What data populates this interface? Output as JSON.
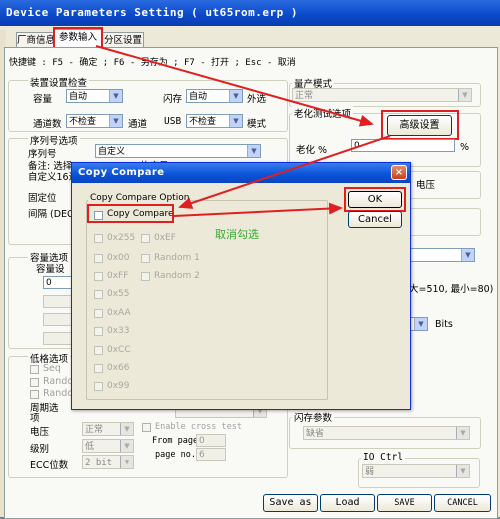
{
  "window": {
    "title": "Device Parameters Setting ( ut65rom.erp )"
  },
  "tabs": [
    {
      "label": "厂商信息"
    },
    {
      "label": "参数输入"
    },
    {
      "label": "分区设置"
    }
  ],
  "shortcut": "快捷键 : F5 - 确定 ; F6 - 另存为 ; F7 - 打开 ; Esc - 取消",
  "device_check": {
    "title": "装置设置检查",
    "capacity_label": "容量",
    "capacity_value": "自动",
    "flash_label": "闪存",
    "flash_value": "自动",
    "outside_label": "外选",
    "channel_count_label": "通道数",
    "channel_count_value": "不检查",
    "channel_label": "通道",
    "usb_label": "USB",
    "usb_value": "不检查",
    "mode_label": "模式"
  },
  "serial": {
    "title": "序列号选项",
    "serial_label": "序列号",
    "serial_value": "自定义",
    "note1": "备注: 选择",
    "note1_tail": "的序号...",
    "note2": "自定义16进",
    "fixed_label": "固定位",
    "interval_label": "间隔 (DEC)"
  },
  "capacity_opts": {
    "title": "容量选项 (",
    "sub": "容量设",
    "value0": "0"
  },
  "lowfmt": {
    "title": "低格选项",
    "seq": "Seq",
    "random1": "Random",
    "random2": "Random",
    "cycle_label": "周期选",
    "cycle_sub": "项",
    "voltage_label": "电压",
    "voltage_value": "正常",
    "level_label": "级别",
    "level_value": "低",
    "ecc_label": "ECC位数",
    "ecc_value": "2 bit",
    "enable_cross": "Enable cross test",
    "from_page": "From page",
    "from_value": "0",
    "page_no": "page no.",
    "page_no_value": "6"
  },
  "right": {
    "production_title": "量产模式",
    "production_value": "正常",
    "aging_title": "老化测试选项",
    "advanced_button": "高级设置",
    "aging_label": "老化 %",
    "aging_value": "0",
    "percent": "%",
    "voltage_label": "电压",
    "size_note": "大=510, 最小=80)",
    "bits_label": "Bits",
    "flash_params_title": "闪存参数",
    "flash_params_value": "缺省",
    "io_title": "IO Ctrl",
    "io_value": "弱"
  },
  "bottom_buttons": {
    "save_as": "Save as",
    "load": "Load",
    "save": "SAVE",
    "cancel": "CANCEL"
  },
  "dialog": {
    "title": "Copy Compare",
    "close": "×",
    "group_title": "Copy Compare Option",
    "copy_compare_label": "Copy Compare",
    "ok_label": "OK",
    "cancel_label": "Cancel",
    "annotation": "取消勾选",
    "options_left": [
      "0x55",
      "0x00",
      "0xFF",
      "0x55",
      "0xAA",
      "0x33",
      "0xCC",
      "0x66",
      "0x99"
    ],
    "options_left_first": "0x255",
    "options_right": [
      "0xEF",
      "Random 1",
      "Random 2"
    ]
  },
  "colors": {
    "annotation_red": "#e02020",
    "annotation_green": "#3aa832"
  }
}
